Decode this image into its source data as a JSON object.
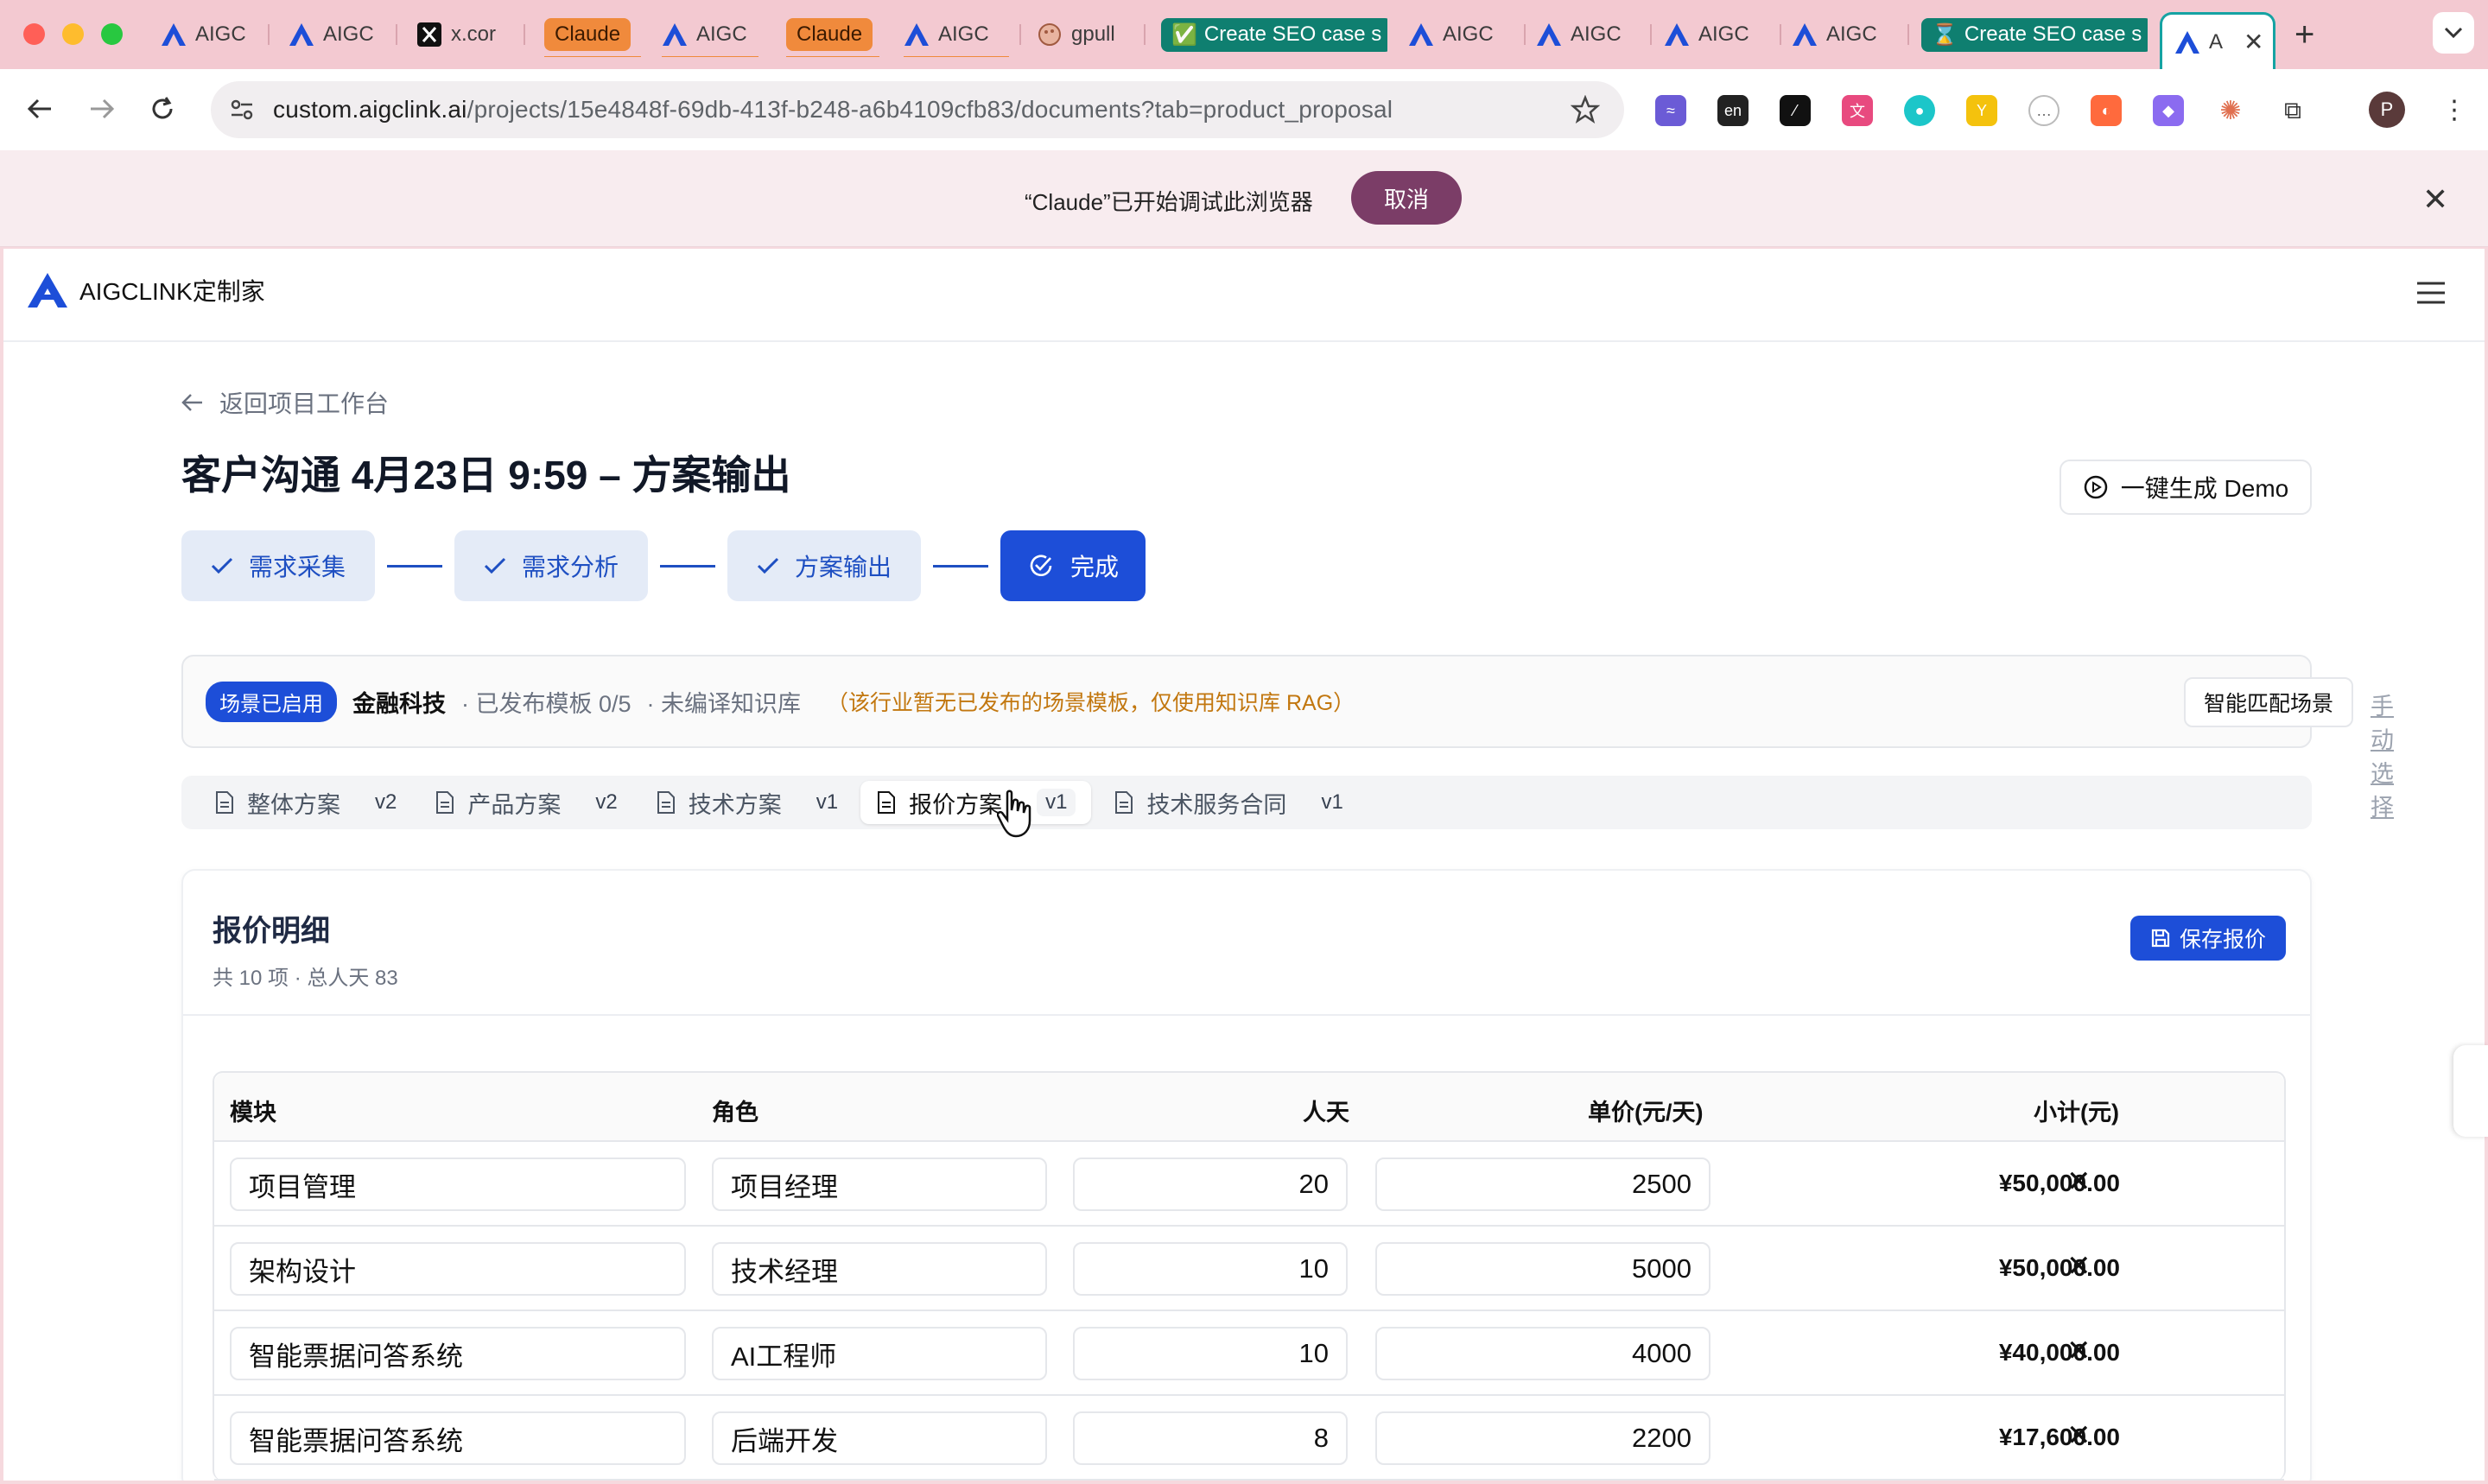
{
  "browser": {
    "tabs": [
      {
        "label": "AIGC",
        "icon": "aigclink-logo-icon"
      },
      {
        "label": "AIGC",
        "icon": "aigclink-logo-icon"
      },
      {
        "label": "x.cor",
        "icon": "x-logo-icon"
      },
      {
        "label": "Claude",
        "icon": "claude-pill"
      },
      {
        "label": "AIGC",
        "icon": "aigclink-logo-icon"
      },
      {
        "label": "Claude",
        "icon": "claude-pill"
      },
      {
        "label": "AIGC",
        "icon": "aigclink-logo-icon"
      },
      {
        "label": "gpull",
        "icon": "palette-icon"
      },
      {
        "label": "Create SEO case s",
        "icon": "check-emoji-icon"
      },
      {
        "label": "AIGC",
        "icon": "aigclink-logo-icon"
      },
      {
        "label": "AIGC",
        "icon": "aigclink-logo-icon"
      },
      {
        "label": "AIGC",
        "icon": "aigclink-logo-icon"
      },
      {
        "label": "AIGC",
        "icon": "aigclink-logo-icon"
      },
      {
        "label": "Create SEO case s",
        "icon": "hourglass-emoji-icon"
      },
      {
        "label": "A",
        "icon": "aigclink-logo-icon"
      }
    ],
    "url_host": "custom.aigclink.ai",
    "url_path": "/projects/15e4848f-69db-413f-b248-a6b4109cfb83/documents?tab=product_proposal",
    "profile_initial": "P"
  },
  "debug_bar": {
    "message": "“Claude”已开始调试此浏览器",
    "cancel_label": "取消"
  },
  "app": {
    "brand": "AIGCLINK定制家",
    "back_label": "返回项目工作台",
    "page_title": "客户沟通 4月23日 9:59 – 方案输出",
    "demo_button": "一键生成 Demo",
    "steps": [
      {
        "label": "需求采集"
      },
      {
        "label": "需求分析"
      },
      {
        "label": "方案输出"
      },
      {
        "label": "完成"
      }
    ],
    "scene": {
      "badge": "场景已启用",
      "industry": "金融科技",
      "template_info": "· 已发布模板 0/5",
      "kb_info": "· 未编译知识库",
      "warning": "（该行业暂无已发布的场景模板，仅使用知识库 RAG）",
      "smart_match": "智能匹配场景",
      "manual_select": "手动选择"
    },
    "doc_tabs": [
      {
        "label": "整体方案",
        "version": "v2"
      },
      {
        "label": "产品方案",
        "version": "v2"
      },
      {
        "label": "技术方案",
        "version": "v1"
      },
      {
        "label": "报价方案",
        "version": "v1"
      },
      {
        "label": "技术服务合同",
        "version": "v1"
      }
    ],
    "quote": {
      "title": "报价明细",
      "summary": "共 10 项 · 总人天 83",
      "save_label": "保存报价",
      "columns": [
        "模块",
        "角色",
        "人天",
        "单价(元/天)",
        "小计(元)"
      ],
      "rows": [
        {
          "module": "项目管理",
          "role": "项目经理",
          "days": "20",
          "rate": "2500",
          "subtotal": "¥50,000.00"
        },
        {
          "module": "架构设计",
          "role": "技术经理",
          "days": "10",
          "rate": "5000",
          "subtotal": "¥50,000.00"
        },
        {
          "module": "智能票据问答系统",
          "role": "AI工程师",
          "days": "10",
          "rate": "4000",
          "subtotal": "¥40,000.00"
        },
        {
          "module": "智能票据问答系统",
          "role": "后端开发",
          "days": "8",
          "rate": "2200",
          "subtotal": "¥17,600.00"
        }
      ]
    }
  },
  "colors": {
    "accent": "#1d4ed8",
    "tabstrip": "#f3c9d1",
    "warning": "#c2770f"
  }
}
